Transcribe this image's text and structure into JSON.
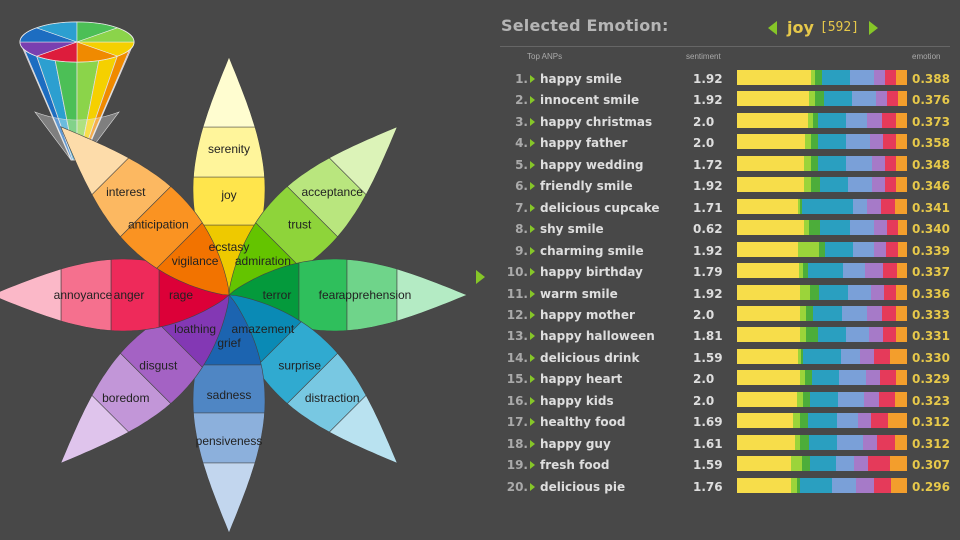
{
  "wheel": {
    "petals": [
      {
        "name": "joy",
        "angle": 0,
        "inner": "ecstasy",
        "middle": "joy",
        "outer": "serenity",
        "colors": [
          "#eec900",
          "#ffe54c",
          "#fff59b",
          "#fffdd0"
        ]
      },
      {
        "name": "trust",
        "angle": 45,
        "inner": "admiration",
        "middle": "trust",
        "outer": "acceptance",
        "colors": [
          "#64c400",
          "#8ed43a",
          "#b9e67e",
          "#dcf3b8"
        ]
      },
      {
        "name": "fear",
        "angle": 90,
        "inner": "terror",
        "middle": "fear",
        "outer": "apprehension",
        "colors": [
          "#049a3c",
          "#2fbf5c",
          "#6fd48a",
          "#b4ebc4"
        ]
      },
      {
        "name": "surprise",
        "angle": 135,
        "inner": "amazement",
        "middle": "surprise",
        "outer": "distraction",
        "colors": [
          "#0a8ab5",
          "#30aad0",
          "#78c8e2",
          "#b9e2f0"
        ]
      },
      {
        "name": "sadness",
        "angle": 180,
        "inner": "grief",
        "middle": "sadness",
        "outer": "pensiveness",
        "colors": [
          "#1c64b0",
          "#4f86c4",
          "#8cb0dc",
          "#c2d6ee"
        ]
      },
      {
        "name": "disgust",
        "angle": 225,
        "inner": "loathing",
        "middle": "disgust",
        "outer": "boredom",
        "colors": [
          "#8338b4",
          "#a462c4",
          "#c296d8",
          "#dfc4ec"
        ]
      },
      {
        "name": "anger",
        "angle": 270,
        "inner": "rage",
        "middle": "anger",
        "outer": "annoyance",
        "colors": [
          "#dc0038",
          "#ee2a5a",
          "#f5708e",
          "#fbb8c8"
        ]
      },
      {
        "name": "anticipation",
        "angle": 315,
        "inner": "vigilance",
        "middle": "anticipation",
        "outer": "interest",
        "colors": [
          "#f27300",
          "#fa9322",
          "#fcb861",
          "#fddcaa"
        ]
      }
    ],
    "cone_colors": [
      "#7a3fb0",
      "#1d6dc1",
      "#2c9fd0",
      "#4cbf56",
      "#8bd44a",
      "#f5d000",
      "#f08a00",
      "#dd1c3c"
    ]
  },
  "panel": {
    "title": "Selected Emotion:",
    "emotion": "joy",
    "count": "[592]",
    "headers": {
      "anp": "Top ANPs",
      "sentiment": "sentiment",
      "emotion": "emotion"
    }
  },
  "bar_colors": [
    "#f7dd4a",
    "#9bd43a",
    "#4cad3a",
    "#2a9fc0",
    "#7aa0d8",
    "#a67ac8",
    "#e53a5a",
    "#f39e2c"
  ],
  "rows": [
    {
      "rank": "1.",
      "anp": "happy smile",
      "sentiment": "1.92",
      "emotion": "0.388",
      "mix": [
        0.4,
        0.02,
        0.04,
        0.15,
        0.13,
        0.06,
        0.06,
        0.06
      ]
    },
    {
      "rank": "2.",
      "anp": "innocent smile",
      "sentiment": "1.92",
      "emotion": "0.376",
      "mix": [
        0.39,
        0.03,
        0.05,
        0.15,
        0.13,
        0.06,
        0.06,
        0.05
      ]
    },
    {
      "rank": "3.",
      "anp": "happy christmas",
      "sentiment": "2.0",
      "emotion": "0.373",
      "mix": [
        0.39,
        0.03,
        0.03,
        0.15,
        0.12,
        0.08,
        0.08,
        0.06
      ]
    },
    {
      "rank": "4.",
      "anp": "happy father",
      "sentiment": "2.0",
      "emotion": "0.358",
      "mix": [
        0.37,
        0.03,
        0.04,
        0.15,
        0.13,
        0.07,
        0.07,
        0.06
      ]
    },
    {
      "rank": "5.",
      "anp": "happy wedding",
      "sentiment": "1.72",
      "emotion": "0.348",
      "mix": [
        0.36,
        0.04,
        0.04,
        0.15,
        0.14,
        0.07,
        0.06,
        0.06
      ]
    },
    {
      "rank": "6.",
      "anp": "friendly smile",
      "sentiment": "1.92",
      "emotion": "0.346",
      "mix": [
        0.36,
        0.04,
        0.05,
        0.15,
        0.13,
        0.07,
        0.06,
        0.06
      ]
    },
    {
      "rank": "7.",
      "anp": "delicious cupcake",
      "sentiment": "1.71",
      "emotion": "0.341",
      "mix": [
        0.35,
        0.01,
        0.01,
        0.29,
        0.08,
        0.08,
        0.08,
        0.07
      ]
    },
    {
      "rank": "8.",
      "anp": "shy smile",
      "sentiment": "0.62",
      "emotion": "0.340",
      "mix": [
        0.36,
        0.03,
        0.06,
        0.16,
        0.13,
        0.07,
        0.06,
        0.05
      ]
    },
    {
      "rank": "9.",
      "anp": "charming smile",
      "sentiment": "1.92",
      "emotion": "0.339",
      "mix": [
        0.35,
        0.12,
        0.04,
        0.16,
        0.12,
        0.07,
        0.07,
        0.05
      ]
    },
    {
      "rank": "10.",
      "anp": "happy birthday",
      "sentiment": "1.79",
      "emotion": "0.337",
      "mix": [
        0.36,
        0.02,
        0.03,
        0.2,
        0.13,
        0.1,
        0.08,
        0.06
      ]
    },
    {
      "rank": "11.",
      "anp": "warm smile",
      "sentiment": "1.92",
      "emotion": "0.336",
      "mix": [
        0.35,
        0.06,
        0.05,
        0.16,
        0.13,
        0.07,
        0.07,
        0.06
      ]
    },
    {
      "rank": "12.",
      "anp": "happy mother",
      "sentiment": "2.0",
      "emotion": "0.333",
      "mix": [
        0.35,
        0.03,
        0.04,
        0.16,
        0.14,
        0.08,
        0.08,
        0.06
      ]
    },
    {
      "rank": "13.",
      "anp": "happy halloween",
      "sentiment": "1.81",
      "emotion": "0.331",
      "mix": [
        0.35,
        0.03,
        0.07,
        0.15,
        0.13,
        0.08,
        0.07,
        0.06
      ]
    },
    {
      "rank": "14.",
      "anp": "delicious drink",
      "sentiment": "1.59",
      "emotion": "0.330",
      "mix": [
        0.35,
        0.02,
        0.01,
        0.22,
        0.11,
        0.08,
        0.09,
        0.1
      ]
    },
    {
      "rank": "15.",
      "anp": "happy heart",
      "sentiment": "2.0",
      "emotion": "0.329",
      "mix": [
        0.35,
        0.03,
        0.04,
        0.15,
        0.15,
        0.08,
        0.09,
        0.06
      ]
    },
    {
      "rank": "16.",
      "anp": "happy kids",
      "sentiment": "2.0",
      "emotion": "0.323",
      "mix": [
        0.34,
        0.03,
        0.04,
        0.16,
        0.15,
        0.08,
        0.09,
        0.07
      ]
    },
    {
      "rank": "17.",
      "anp": "healthy food",
      "sentiment": "1.69",
      "emotion": "0.312",
      "mix": [
        0.33,
        0.04,
        0.05,
        0.17,
        0.12,
        0.08,
        0.1,
        0.11
      ]
    },
    {
      "rank": "18.",
      "anp": "happy guy",
      "sentiment": "1.61",
      "emotion": "0.312",
      "mix": [
        0.33,
        0.03,
        0.05,
        0.16,
        0.15,
        0.08,
        0.1,
        0.07
      ]
    },
    {
      "rank": "19.",
      "anp": "fresh food",
      "sentiment": "1.59",
      "emotion": "0.307",
      "mix": [
        0.32,
        0.06,
        0.05,
        0.15,
        0.11,
        0.08,
        0.13,
        0.1
      ]
    },
    {
      "rank": "20.",
      "anp": "delicious pie",
      "sentiment": "1.76",
      "emotion": "0.296",
      "mix": [
        0.31,
        0.03,
        0.02,
        0.18,
        0.14,
        0.1,
        0.1,
        0.09
      ]
    }
  ]
}
